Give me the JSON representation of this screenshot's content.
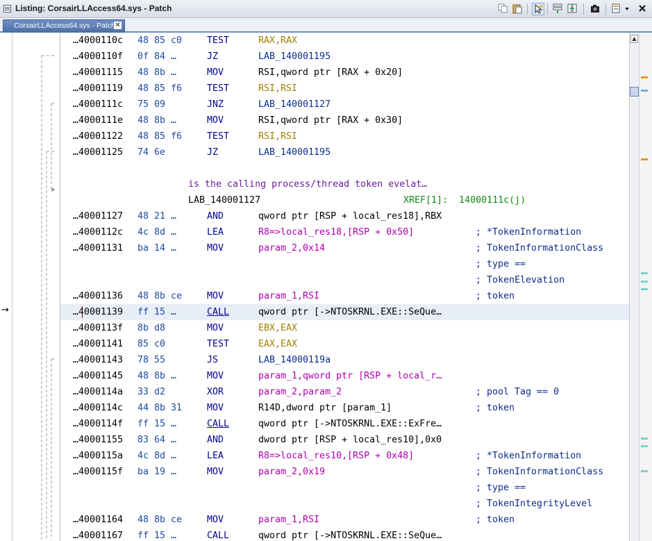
{
  "window": {
    "title": "Listing:  CorsairLLAccess64.sys - Patch"
  },
  "tabs": [
    {
      "label": "CorsairLLAccess64.sys - Patch",
      "close": "✕"
    }
  ],
  "scrollbar": {
    "up_arrow": "▲"
  },
  "colors": {
    "accent": "#4d6ea6",
    "selection": "#5a9be8",
    "highlight_row": "#e8eef8"
  },
  "listing": {
    "rows": [
      {
        "addr": "…4000110c",
        "bytes": "48 85 c0",
        "mnemonic": "TEST",
        "operands": "RAX,RAX"
      },
      {
        "addr": "…4000110f",
        "bytes": "0f 84 …",
        "mnemonic": "JZ",
        "operands": "LAB_140001195"
      },
      {
        "addr": "…40001115",
        "bytes": "48 8b …",
        "mnemonic": "MOV",
        "operands": "RSI,qword ptr [RAX + 0x20]"
      },
      {
        "addr": "…40001119",
        "bytes": "48 85 f6",
        "mnemonic": "TEST",
        "operands": "RSI,RSI"
      },
      {
        "addr": "…4000111c",
        "bytes": "75 09",
        "mnemonic": "JNZ",
        "operands": "LAB_140001127"
      },
      {
        "addr": "…4000111e",
        "bytes": "48 8b …",
        "mnemonic": "MOV",
        "operands": "RSI,qword ptr [RAX + 0x30]"
      },
      {
        "addr": "…40001122",
        "bytes": "48 85 f6",
        "mnemonic": "TEST",
        "operands": "RSI,RSI"
      },
      {
        "addr": "…40001125",
        "bytes": "74 6e",
        "mnemonic": "JZ",
        "operands": "LAB_140001195"
      }
    ],
    "plate_comment": "is the calling process/thread token evelat…",
    "label": "LAB_140001127",
    "xref": "XREF[1]:  14000111c(j)",
    "rows2": [
      {
        "addr": "…40001127",
        "bytes": "48 21 …",
        "mnemonic": "AND",
        "operands": "qword ptr [RSP + local_res18],RBX",
        "comment": ""
      },
      {
        "addr": "…4000112c",
        "bytes": "4c 8d …",
        "mnemonic": "LEA",
        "operands": "R8=>local_res18,[RSP + 0x50]",
        "comment": "; *TokenInformation"
      },
      {
        "addr": "…40001131",
        "bytes": "ba 14 …",
        "mnemonic": "MOV",
        "operands": "param_2,0x14",
        "comment": "; TokenInformationClass"
      },
      {
        "addr": "",
        "bytes": "",
        "mnemonic": "",
        "operands": "",
        "comment": "; type =="
      },
      {
        "addr": "",
        "bytes": "",
        "mnemonic": "",
        "operands": "",
        "comment": "; TokenElevation"
      },
      {
        "addr": "…40001136",
        "bytes": "48 8b ce",
        "mnemonic": "MOV",
        "operands": "param_1,RSI",
        "comment": "; token"
      },
      {
        "addr": "…40001139",
        "bytes": "ff 15 …",
        "mnemonic": "CALL",
        "operands": "qword ptr [->NTOSKRNL.EXE::SeQue…",
        "comment": ""
      },
      {
        "addr": "…4000113f",
        "bytes": "8b d8",
        "mnemonic": "MOV",
        "operands": "EBX,EAX",
        "comment": ""
      },
      {
        "addr": "…40001141",
        "bytes": "85 c0",
        "mnemonic": "TEST",
        "operands": "EAX,EAX",
        "comment": ""
      },
      {
        "addr": "…40001143",
        "bytes": "78 55",
        "mnemonic": "JS",
        "operands": "LAB_14000119a",
        "comment": ""
      },
      {
        "addr": "…40001145",
        "bytes": "48 8b …",
        "mnemonic": "MOV",
        "operands": "param_1,qword ptr [RSP + local_r…",
        "comment": ""
      },
      {
        "addr": "…4000114a",
        "bytes": "33 d2",
        "mnemonic": "XOR",
        "operands": "param_2,param_2",
        "comment": "; pool Tag == 0"
      },
      {
        "addr": "…4000114c",
        "bytes": "44 8b 31",
        "mnemonic": "MOV",
        "operands": "R14D,dword ptr [param_1]",
        "comment": "; token"
      },
      {
        "addr": "…4000114f",
        "bytes": "ff 15 …",
        "mnemonic": "CALL",
        "operands": "qword ptr [->NTOSKRNL.EXE::ExFre…",
        "comment": ""
      },
      {
        "addr": "…40001155",
        "bytes": "83 64 …",
        "mnemonic": "AND",
        "operands": "dword ptr [RSP + local_res10],0x0",
        "comment": ""
      },
      {
        "addr": "…4000115a",
        "bytes": "4c 8d …",
        "mnemonic": "LEA",
        "operands": "R8=>local_res10,[RSP + 0x48]",
        "comment": "; *TokenInformation"
      },
      {
        "addr": "…4000115f",
        "bytes": "ba 19 …",
        "mnemonic": "MOV",
        "operands": "param_2,0x19",
        "comment": "; TokenInformationClass"
      },
      {
        "addr": "",
        "bytes": "",
        "mnemonic": "",
        "operands": "",
        "comment": "; type =="
      },
      {
        "addr": "",
        "bytes": "",
        "mnemonic": "",
        "operands": "",
        "comment": "; TokenIntegrityLevel"
      },
      {
        "addr": "…40001164",
        "bytes": "48 8b ce",
        "mnemonic": "MOV",
        "operands": "param_1,RSI",
        "comment": "; token"
      },
      {
        "addr": "…40001167",
        "bytes": "ff 15 …",
        "mnemonic": "CALL",
        "operands": "qword ptr [->NTOSKRNL.EXE::SeQue…",
        "comment": ""
      }
    ]
  }
}
